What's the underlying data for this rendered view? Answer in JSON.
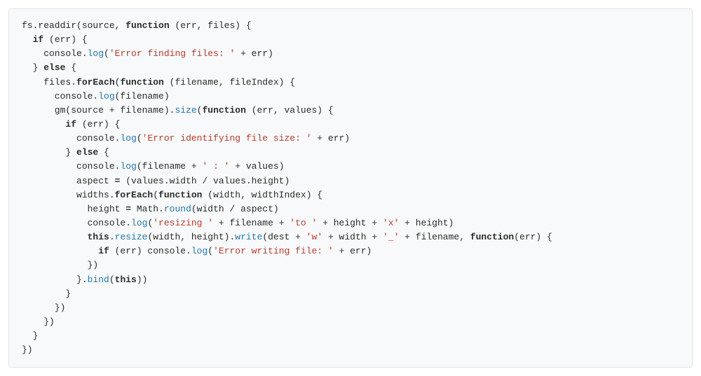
{
  "code": {
    "tokens": [
      [
        [
          "plain",
          "fs.readdir(source, "
        ],
        [
          "kw",
          "function"
        ],
        [
          "plain",
          " (err, files) {"
        ]
      ],
      [
        [
          "plain",
          "  "
        ],
        [
          "kw",
          "if"
        ],
        [
          "plain",
          " (err) {"
        ]
      ],
      [
        [
          "plain",
          "    console."
        ],
        [
          "fn",
          "log"
        ],
        [
          "plain",
          "("
        ],
        [
          "str",
          "'Error finding files: '"
        ],
        [
          "plain",
          " + err)"
        ]
      ],
      [
        [
          "plain",
          "  } "
        ],
        [
          "kw",
          "else"
        ],
        [
          "plain",
          " {"
        ]
      ],
      [
        [
          "plain",
          "    files."
        ],
        [
          "kw",
          "forEach"
        ],
        [
          "plain",
          "("
        ],
        [
          "kw",
          "function"
        ],
        [
          "plain",
          " (filename, fileIndex) {"
        ]
      ],
      [
        [
          "plain",
          "      console."
        ],
        [
          "fn",
          "log"
        ],
        [
          "plain",
          "(filename)"
        ]
      ],
      [
        [
          "plain",
          "      gm(source + filename)."
        ],
        [
          "fn",
          "size"
        ],
        [
          "plain",
          "("
        ],
        [
          "kw",
          "function"
        ],
        [
          "plain",
          " (err, values) {"
        ]
      ],
      [
        [
          "plain",
          "        "
        ],
        [
          "kw",
          "if"
        ],
        [
          "plain",
          " (err) {"
        ]
      ],
      [
        [
          "plain",
          "          console."
        ],
        [
          "fn",
          "log"
        ],
        [
          "plain",
          "("
        ],
        [
          "str",
          "'Error identifying file size: '"
        ],
        [
          "plain",
          " + err)"
        ]
      ],
      [
        [
          "plain",
          "        } "
        ],
        [
          "kw",
          "else"
        ],
        [
          "plain",
          " {"
        ]
      ],
      [
        [
          "plain",
          "          console."
        ],
        [
          "fn",
          "log"
        ],
        [
          "plain",
          "(filename + "
        ],
        [
          "str",
          "' : '"
        ],
        [
          "plain",
          " + values)"
        ]
      ],
      [
        [
          "plain",
          "          aspect "
        ],
        [
          "kw",
          "="
        ],
        [
          "plain",
          " (values.width / values.height)"
        ]
      ],
      [
        [
          "plain",
          "          widths."
        ],
        [
          "kw",
          "forEach"
        ],
        [
          "plain",
          "("
        ],
        [
          "kw",
          "function"
        ],
        [
          "plain",
          " (width, widthIndex) {"
        ]
      ],
      [
        [
          "plain",
          "            height "
        ],
        [
          "kw",
          "="
        ],
        [
          "plain",
          " Math."
        ],
        [
          "fn",
          "round"
        ],
        [
          "plain",
          "(width / aspect)"
        ]
      ],
      [
        [
          "plain",
          "            console."
        ],
        [
          "fn",
          "log"
        ],
        [
          "plain",
          "("
        ],
        [
          "str",
          "'resizing '"
        ],
        [
          "plain",
          " + filename + "
        ],
        [
          "str",
          "'to '"
        ],
        [
          "plain",
          " + height + "
        ],
        [
          "str",
          "'x'"
        ],
        [
          "plain",
          " + height)"
        ]
      ],
      [
        [
          "plain",
          "            "
        ],
        [
          "kw",
          "this"
        ],
        [
          "plain",
          "."
        ],
        [
          "fn",
          "resize"
        ],
        [
          "plain",
          "(width, height)."
        ],
        [
          "fn",
          "write"
        ],
        [
          "plain",
          "(dest + "
        ],
        [
          "str",
          "'w'"
        ],
        [
          "plain",
          " + width + "
        ],
        [
          "str",
          "'_'"
        ],
        [
          "plain",
          " + filename, "
        ],
        [
          "kw",
          "function"
        ],
        [
          "plain",
          "(err) {"
        ]
      ],
      [
        [
          "plain",
          "              "
        ],
        [
          "kw",
          "if"
        ],
        [
          "plain",
          " (err) console."
        ],
        [
          "fn",
          "log"
        ],
        [
          "plain",
          "("
        ],
        [
          "str",
          "'Error writing file: '"
        ],
        [
          "plain",
          " + err)"
        ]
      ],
      [
        [
          "plain",
          "            })"
        ]
      ],
      [
        [
          "plain",
          "          }."
        ],
        [
          "fn",
          "bind"
        ],
        [
          "plain",
          "("
        ],
        [
          "kw",
          "this"
        ],
        [
          "plain",
          "))"
        ]
      ],
      [
        [
          "plain",
          "        }"
        ]
      ],
      [
        [
          "plain",
          "      })"
        ]
      ],
      [
        [
          "plain",
          "    })"
        ]
      ],
      [
        [
          "plain",
          "  }"
        ]
      ],
      [
        [
          "plain",
          "})"
        ]
      ]
    ]
  }
}
